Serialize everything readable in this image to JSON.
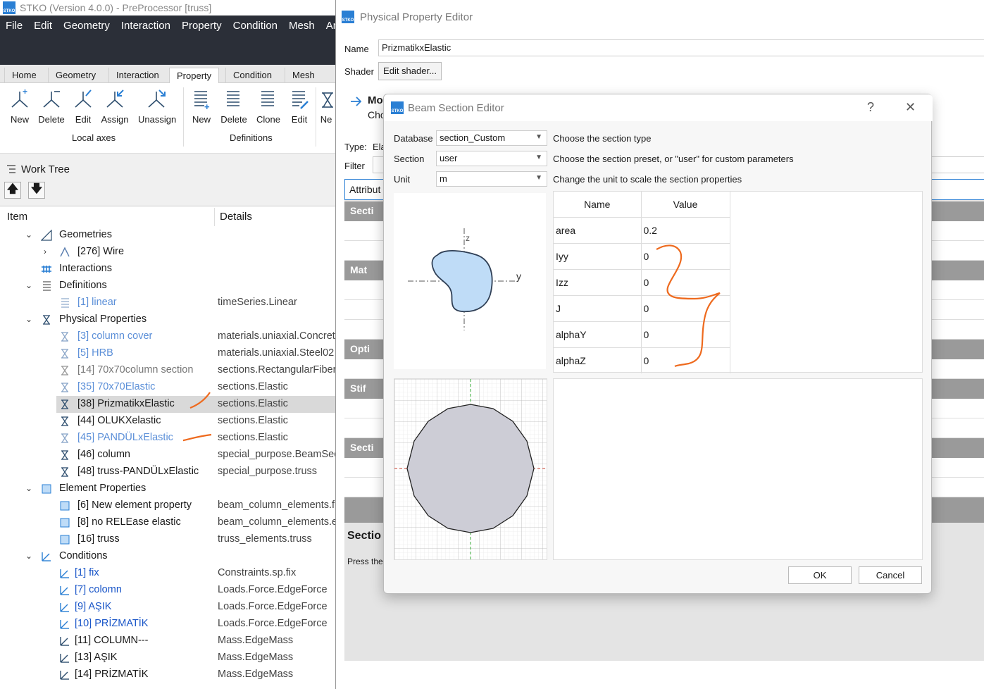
{
  "main": {
    "title": "STKO (Version 4.0.0) - PreProcessor [truss]",
    "menu": [
      "File",
      "Edit",
      "Geometry",
      "Interaction",
      "Property",
      "Condition",
      "Mesh",
      "An"
    ],
    "ribbon_tabs": [
      "Home",
      "Geometry",
      "Interaction",
      "Property",
      "Condition",
      "Mesh"
    ],
    "local_axes": {
      "buttons": [
        "New",
        "Delete",
        "Edit",
        "Assign",
        "Unassign"
      ],
      "label": "Local axes"
    },
    "definitions": {
      "buttons": [
        "New",
        "Delete",
        "Clone",
        "Edit"
      ],
      "label": "Definitions"
    },
    "partial_button": "Ne"
  },
  "worktree": {
    "title": "Work Tree",
    "columns": [
      "Item",
      "Details"
    ],
    "rows": [
      {
        "label": "Geometries",
        "details": ""
      },
      {
        "label": "[276] Wire",
        "details": ""
      },
      {
        "label": "Interactions",
        "details": ""
      },
      {
        "label": "Definitions",
        "details": ""
      },
      {
        "label": "[1] linear",
        "details": "timeSeries.Linear"
      },
      {
        "label": "Physical Properties",
        "details": ""
      },
      {
        "label": "[3] column cover",
        "details": "materials.uniaxial.Concret"
      },
      {
        "label": "[5] HRB",
        "details": "materials.uniaxial.Steel02"
      },
      {
        "label": "[14] 70x70column section",
        "details": "sections.RectangularFiber"
      },
      {
        "label": "[35] 70x70Elastic",
        "details": "sections.Elastic"
      },
      {
        "label": "[38] PrizmatikxElastic",
        "details": "sections.Elastic"
      },
      {
        "label": "[44] OLUKXelastic",
        "details": "sections.Elastic"
      },
      {
        "label": "[45] PANDÜLxElastic",
        "details": "sections.Elastic"
      },
      {
        "label": "[46] column",
        "details": "special_purpose.BeamSec"
      },
      {
        "label": "[48] truss-PANDÜLxElastic",
        "details": "special_purpose.truss"
      },
      {
        "label": "Element Properties",
        "details": ""
      },
      {
        "label": "[6] New element property",
        "details": "beam_column_elements.f"
      },
      {
        "label": "[8] no RELEase elastic",
        "details": "beam_column_elements.e"
      },
      {
        "label": "[16] truss",
        "details": "truss_elements.truss"
      },
      {
        "label": "Conditions",
        "details": ""
      },
      {
        "label": "[1] fix",
        "details": "Constraints.sp.fix"
      },
      {
        "label": "[7] colomn",
        "details": "Loads.Force.EdgeForce"
      },
      {
        "label": "[9] AŞIK",
        "details": "Loads.Force.EdgeForce"
      },
      {
        "label": "[10] PRİZMATİK",
        "details": "Loads.Force.EdgeForce"
      },
      {
        "label": "[11] COLUMN---",
        "details": "Mass.EdgeMass"
      },
      {
        "label": "[13] AŞIK",
        "details": "Mass.EdgeMass"
      },
      {
        "label": "[14] PRİZMATİK",
        "details": "Mass.EdgeMass"
      }
    ]
  },
  "ppe": {
    "title": "Physical Property Editor",
    "name_label": "Name",
    "name_value": "PrizmatikxElastic",
    "shader_label": "Shader",
    "shader_button": "Edit shader...",
    "mo": "Mo",
    "cho": "Cho",
    "type_label": "Type:",
    "type_value": "Ela",
    "filter_label": "Filter",
    "attrib_tab": "Attribut",
    "sections": [
      "Secti",
      "Mat",
      "Opti",
      "Stif",
      "Secti"
    ],
    "section_footer": "Sectio",
    "press_the": "Press the"
  },
  "bse": {
    "title": "Beam Section Editor",
    "help": "?",
    "close": "✕",
    "fields": [
      {
        "label": "Database",
        "value": "section_Custom",
        "hint": "Choose the section type"
      },
      {
        "label": "Section",
        "value": "user",
        "hint": "Choose the section preset, or \"user\" for custom parameters"
      },
      {
        "label": "Unit",
        "value": "m",
        "hint": "Change the unit to scale the section properties"
      }
    ],
    "table": {
      "headers": [
        "Name",
        "Value"
      ],
      "rows": [
        {
          "name": "area",
          "value": "0.2"
        },
        {
          "name": "Iyy",
          "value": "0"
        },
        {
          "name": "Izz",
          "value": "0"
        },
        {
          "name": "J",
          "value": "0"
        },
        {
          "name": "alphaY",
          "value": "0"
        },
        {
          "name": "alphaZ",
          "value": "0"
        }
      ]
    },
    "axis_z": "z",
    "axis_y": "y",
    "ok": "OK",
    "cancel": "Cancel"
  },
  "colors": {
    "menubar": "#2b2f38",
    "accent": "#2a7fd4",
    "annotation": "#ee6a1e",
    "section_fill": "#bfdcf7",
    "polygon_fill": "#cdcdd6"
  }
}
